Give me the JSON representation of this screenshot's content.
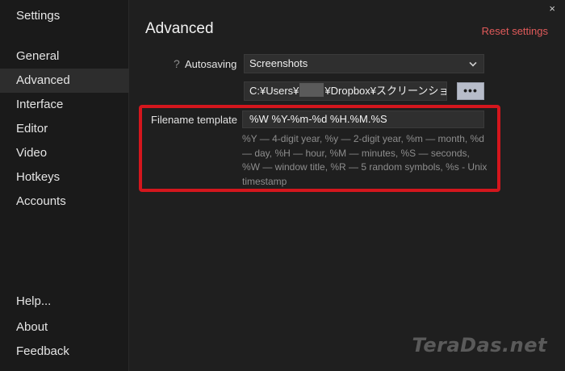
{
  "sidebar": {
    "title": "Settings",
    "items": [
      {
        "id": "general",
        "label": "General"
      },
      {
        "id": "advanced",
        "label": "Advanced"
      },
      {
        "id": "interface",
        "label": "Interface"
      },
      {
        "id": "editor",
        "label": "Editor"
      },
      {
        "id": "video",
        "label": "Video"
      },
      {
        "id": "hotkeys",
        "label": "Hotkeys"
      },
      {
        "id": "accounts",
        "label": "Accounts"
      }
    ],
    "bottom_items": [
      {
        "id": "help",
        "label": "Help..."
      },
      {
        "id": "about",
        "label": "About"
      },
      {
        "id": "feedback",
        "label": "Feedback"
      }
    ],
    "active": "Advanced"
  },
  "main": {
    "close_glyph": "×",
    "title": "Advanced",
    "reset_label": "Reset settings",
    "autosaving": {
      "help_glyph": "?",
      "label": "Autosaving",
      "selected": "Screenshots",
      "path_prefix": "C:¥Users¥",
      "path_suffix": "¥Dropbox¥スクリーンショット",
      "browse_label": "•••"
    },
    "filename_template": {
      "label": "Filename template",
      "value": "%W %Y-%m-%d %H.%M.%S",
      "hint": "%Y — 4-digit year, %y — 2-digit year, %m — month, %d — day, %H — hour, %M — minutes, %S — seconds, %W — window title, %R — 5 random symbols, %s - Unix timestamp"
    }
  },
  "watermark": "TeraDas.net",
  "colors": {
    "accent_red": "#d4161d",
    "reset_link": "#e05a5a",
    "background": "#1f1f1f"
  }
}
